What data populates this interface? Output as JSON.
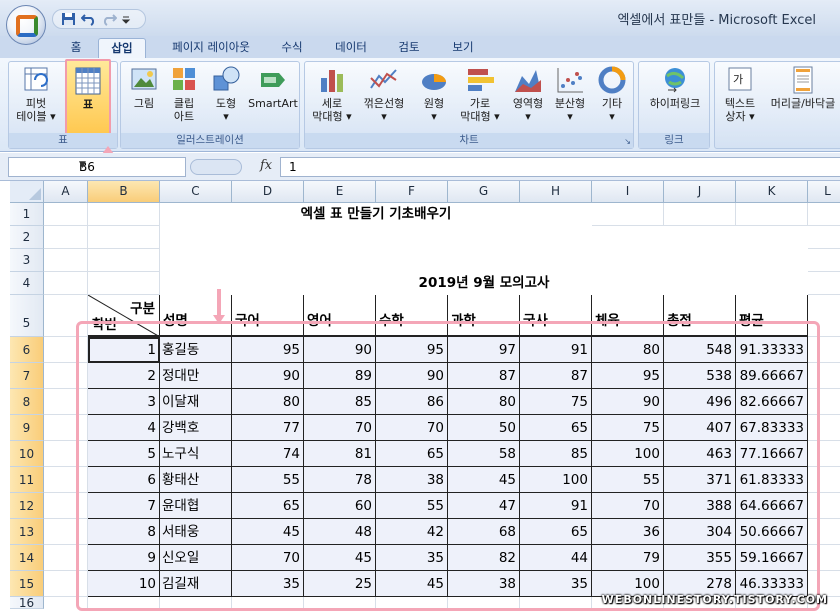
{
  "window": {
    "title": "엑셀에서 표만들 - Microsoft Excel"
  },
  "tabs": [
    "홈",
    "삽입",
    "페이지 레이아웃",
    "수식",
    "데이터",
    "검토",
    "보기"
  ],
  "active_tab": "삽입",
  "ribbon": {
    "groups": [
      {
        "label": "표",
        "buttons": [
          {
            "label": "피벗\n테이블",
            "icon": "pivot-table-icon"
          },
          {
            "label": "표",
            "icon": "table-icon",
            "highlighted": true
          }
        ]
      },
      {
        "label": "일러스트레이션",
        "buttons": [
          {
            "label": "그림",
            "icon": "picture-icon"
          },
          {
            "label": "클립\n아트",
            "icon": "clip-art-icon"
          },
          {
            "label": "도형",
            "icon": "shapes-icon"
          },
          {
            "label": "SmartArt",
            "icon": "smartart-icon"
          }
        ]
      },
      {
        "label": "차트",
        "buttons": [
          {
            "label": "세로\n막대형",
            "icon": "column-chart-icon"
          },
          {
            "label": "꺾은선형",
            "icon": "line-chart-icon"
          },
          {
            "label": "원형",
            "icon": "pie-chart-icon"
          },
          {
            "label": "가로\n막대형",
            "icon": "bar-chart-icon"
          },
          {
            "label": "영역형",
            "icon": "area-chart-icon"
          },
          {
            "label": "분산형",
            "icon": "scatter-chart-icon"
          },
          {
            "label": "기타",
            "icon": "other-chart-icon"
          }
        ]
      },
      {
        "label": "링크",
        "buttons": [
          {
            "label": "하이퍼링크",
            "icon": "hyperlink-icon"
          }
        ]
      },
      {
        "label": "",
        "buttons": [
          {
            "label": "텍스트\n상자",
            "icon": "text-box-icon"
          },
          {
            "label": "머리글/바닥글",
            "icon": "header-footer-icon"
          }
        ]
      }
    ]
  },
  "formula_bar": {
    "name_box": "B6",
    "fx": "fx",
    "value": "1"
  },
  "columns": [
    "A",
    "B",
    "C",
    "D",
    "E",
    "F",
    "G",
    "H",
    "I",
    "J",
    "K",
    "L"
  ],
  "selected_column": "B",
  "rows": [
    "1",
    "2",
    "3",
    "4",
    "5",
    "6",
    "7",
    "8",
    "9",
    "10",
    "11",
    "12",
    "13",
    "14",
    "15",
    "16"
  ],
  "sheet": {
    "title": "엑셀 표 만들기 기초배우기",
    "subtitle": "2019년 9월 모의고사",
    "header": {
      "corner_top": "구분",
      "corner_bottom": "학번",
      "cols": [
        "성명",
        "국어",
        "영어",
        "수학",
        "과학",
        "국사",
        "체육",
        "총점",
        "평균"
      ]
    },
    "records": [
      [
        "1",
        "홍길동",
        "95",
        "90",
        "95",
        "97",
        "91",
        "80",
        "548",
        "91.33333"
      ],
      [
        "2",
        "정대만",
        "90",
        "89",
        "90",
        "87",
        "87",
        "95",
        "538",
        "89.66667"
      ],
      [
        "3",
        "이달재",
        "80",
        "85",
        "86",
        "80",
        "75",
        "90",
        "496",
        "82.66667"
      ],
      [
        "4",
        "강백호",
        "77",
        "70",
        "70",
        "50",
        "65",
        "75",
        "407",
        "67.83333"
      ],
      [
        "5",
        "노구식",
        "74",
        "81",
        "65",
        "58",
        "85",
        "100",
        "463",
        "77.16667"
      ],
      [
        "6",
        "황태산",
        "55",
        "78",
        "38",
        "45",
        "100",
        "55",
        "371",
        "61.83333"
      ],
      [
        "7",
        "윤대협",
        "65",
        "60",
        "55",
        "47",
        "91",
        "70",
        "388",
        "64.66667"
      ],
      [
        "8",
        "서태웅",
        "45",
        "48",
        "42",
        "68",
        "65",
        "36",
        "304",
        "50.66667"
      ],
      [
        "9",
        "신오일",
        "70",
        "45",
        "35",
        "82",
        "44",
        "79",
        "355",
        "59.16667"
      ],
      [
        "10",
        "김길재",
        "35",
        "25",
        "45",
        "38",
        "35",
        "100",
        "278",
        "46.33333"
      ]
    ]
  },
  "watermark": "WEBONLINESTORY.TISTORY.COM",
  "colors": {
    "highlight_pink": "#f4a6b7",
    "table_fill": "#eef1fa",
    "selected_header": "#f9cd79"
  }
}
